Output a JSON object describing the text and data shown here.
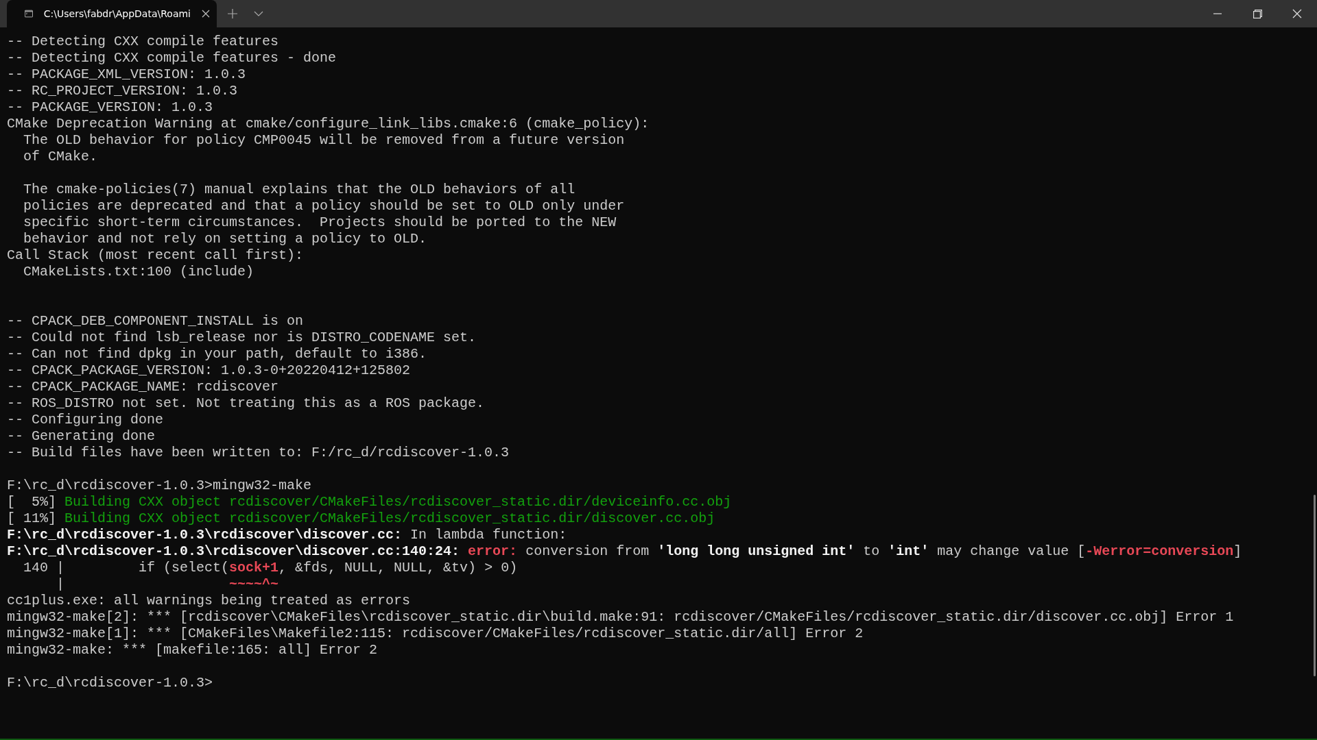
{
  "tab": {
    "title": "C:\\Users\\fabdr\\AppData\\Roami",
    "selected": true
  },
  "terminal": {
    "lines": [
      {
        "kind": "text",
        "segments": [
          {
            "text": "-- Detecting CXX compile features",
            "kind": "plain"
          }
        ]
      },
      {
        "kind": "text",
        "segments": [
          {
            "text": "-- Detecting CXX compile features - done",
            "kind": "plain"
          }
        ]
      },
      {
        "kind": "text",
        "segments": [
          {
            "text": "-- PACKAGE_XML_VERSION: 1.0.3",
            "kind": "plain"
          }
        ]
      },
      {
        "kind": "text",
        "segments": [
          {
            "text": "-- RC_PROJECT_VERSION: 1.0.3",
            "kind": "plain"
          }
        ]
      },
      {
        "kind": "text",
        "segments": [
          {
            "text": "-- PACKAGE_VERSION: 1.0.3",
            "kind": "plain"
          }
        ]
      },
      {
        "kind": "text",
        "segments": [
          {
            "text": "CMake Deprecation Warning at cmake/configure_link_libs.cmake:6 (cmake_policy):",
            "kind": "plain"
          }
        ]
      },
      {
        "kind": "text",
        "segments": [
          {
            "text": "  The OLD behavior for policy CMP0045 will be removed from a future version",
            "kind": "plain"
          }
        ]
      },
      {
        "kind": "text",
        "segments": [
          {
            "text": "  of CMake.",
            "kind": "plain"
          }
        ]
      },
      {
        "kind": "blank"
      },
      {
        "kind": "text",
        "segments": [
          {
            "text": "  The cmake-policies(7) manual explains that the OLD behaviors of all",
            "kind": "plain"
          }
        ]
      },
      {
        "kind": "text",
        "segments": [
          {
            "text": "  policies are deprecated and that a policy should be set to OLD only under",
            "kind": "plain"
          }
        ]
      },
      {
        "kind": "text",
        "segments": [
          {
            "text": "  specific short-term circumstances.  Projects should be ported to the NEW",
            "kind": "plain"
          }
        ]
      },
      {
        "kind": "text",
        "segments": [
          {
            "text": "  behavior and not rely on setting a policy to OLD.",
            "kind": "plain"
          }
        ]
      },
      {
        "kind": "text",
        "segments": [
          {
            "text": "Call Stack (most recent call first):",
            "kind": "plain"
          }
        ]
      },
      {
        "kind": "text",
        "segments": [
          {
            "text": "  CMakeLists.txt:100 (include)",
            "kind": "plain"
          }
        ]
      },
      {
        "kind": "blank"
      },
      {
        "kind": "blank"
      },
      {
        "kind": "text",
        "segments": [
          {
            "text": "-- CPACK_DEB_COMPONENT_INSTALL is on",
            "kind": "plain"
          }
        ]
      },
      {
        "kind": "text",
        "segments": [
          {
            "text": "-- Could not find lsb_release nor is DISTRO_CODENAME set.",
            "kind": "plain"
          }
        ]
      },
      {
        "kind": "text",
        "segments": [
          {
            "text": "-- Can not find dpkg in your path, default to i386.",
            "kind": "plain"
          }
        ]
      },
      {
        "kind": "text",
        "segments": [
          {
            "text": "-- CPACK_PACKAGE_VERSION: 1.0.3-0+20220412+125802",
            "kind": "plain"
          }
        ]
      },
      {
        "kind": "text",
        "segments": [
          {
            "text": "-- CPACK_PACKAGE_NAME: rcdiscover",
            "kind": "plain"
          }
        ]
      },
      {
        "kind": "text",
        "segments": [
          {
            "text": "-- ROS_DISTRO not set. Not treating this as a ROS package.",
            "kind": "plain"
          }
        ]
      },
      {
        "kind": "text",
        "segments": [
          {
            "text": "-- Configuring done",
            "kind": "plain"
          }
        ]
      },
      {
        "kind": "text",
        "segments": [
          {
            "text": "-- Generating done",
            "kind": "plain"
          }
        ]
      },
      {
        "kind": "text",
        "segments": [
          {
            "text": "-- Build files have been written to: F:/rc_d/rcdiscover-1.0.3",
            "kind": "plain"
          }
        ]
      },
      {
        "kind": "blank"
      },
      {
        "kind": "text",
        "segments": [
          {
            "text": "F:\\rc_d\\rcdiscover-1.0.3>mingw32-make",
            "kind": "plain"
          }
        ]
      },
      {
        "kind": "text",
        "segments": [
          {
            "text": "[  5%] ",
            "kind": "plain"
          },
          {
            "text": "Building CXX object rcdiscover/CMakeFiles/rcdiscover_static.dir/deviceinfo.cc.obj",
            "kind": "success"
          }
        ]
      },
      {
        "kind": "text",
        "segments": [
          {
            "text": "[ 11%] ",
            "kind": "plain"
          },
          {
            "text": "Building CXX object rcdiscover/CMakeFiles/rcdiscover_static.dir/discover.cc.obj",
            "kind": "success"
          }
        ]
      },
      {
        "kind": "text",
        "segments": [
          {
            "text": "F:\\rc_d\\rcdiscover-1.0.3\\rcdiscover\\discover.cc:",
            "kind": "emphasis"
          },
          {
            "text": " In lambda function:",
            "kind": "plain"
          }
        ]
      },
      {
        "kind": "text",
        "segments": [
          {
            "text": "F:\\rc_d\\rcdiscover-1.0.3\\rcdiscover\\discover.cc:140:24: ",
            "kind": "emphasis"
          },
          {
            "text": "error:",
            "kind": "error"
          },
          {
            "text": " conversion from ",
            "kind": "plain"
          },
          {
            "text": "'long long unsigned int'",
            "kind": "emphasis"
          },
          {
            "text": " to ",
            "kind": "plain"
          },
          {
            "text": "'int'",
            "kind": "emphasis"
          },
          {
            "text": " may change value [",
            "kind": "plain"
          },
          {
            "text": "-Werror=conversion",
            "kind": "error"
          },
          {
            "text": "]",
            "kind": "plain"
          }
        ]
      },
      {
        "kind": "text",
        "segments": [
          {
            "text": "  140 |         if (select(",
            "kind": "plain"
          },
          {
            "text": "sock+1",
            "kind": "error"
          },
          {
            "text": ", &fds, NULL, NULL, &tv) > 0)",
            "kind": "plain"
          }
        ]
      },
      {
        "kind": "text",
        "segments": [
          {
            "text": "      |                    ",
            "kind": "plain"
          },
          {
            "text": "~~~~^~",
            "kind": "error"
          }
        ]
      },
      {
        "kind": "text",
        "segments": [
          {
            "text": "cc1plus.exe: all warnings being treated as errors",
            "kind": "plain"
          }
        ]
      },
      {
        "kind": "text",
        "segments": [
          {
            "text": "mingw32-make[2]: *** [rcdiscover\\CMakeFiles\\rcdiscover_static.dir\\build.make:91: rcdiscover/CMakeFiles/rcdiscover_static.dir/discover.cc.obj] Error 1",
            "kind": "plain"
          }
        ]
      },
      {
        "kind": "text",
        "segments": [
          {
            "text": "mingw32-make[1]: *** [CMakeFiles\\Makefile2:115: rcdiscover/CMakeFiles/rcdiscover_static.dir/all] Error 2",
            "kind": "plain"
          }
        ]
      },
      {
        "kind": "text",
        "segments": [
          {
            "text": "mingw32-make: *** [makefile:165: all] Error 2",
            "kind": "plain"
          }
        ]
      },
      {
        "kind": "blank"
      },
      {
        "kind": "text",
        "segments": [
          {
            "text": "F:\\rc_d\\rcdiscover-1.0.3>",
            "kind": "plain"
          }
        ]
      }
    ]
  }
}
